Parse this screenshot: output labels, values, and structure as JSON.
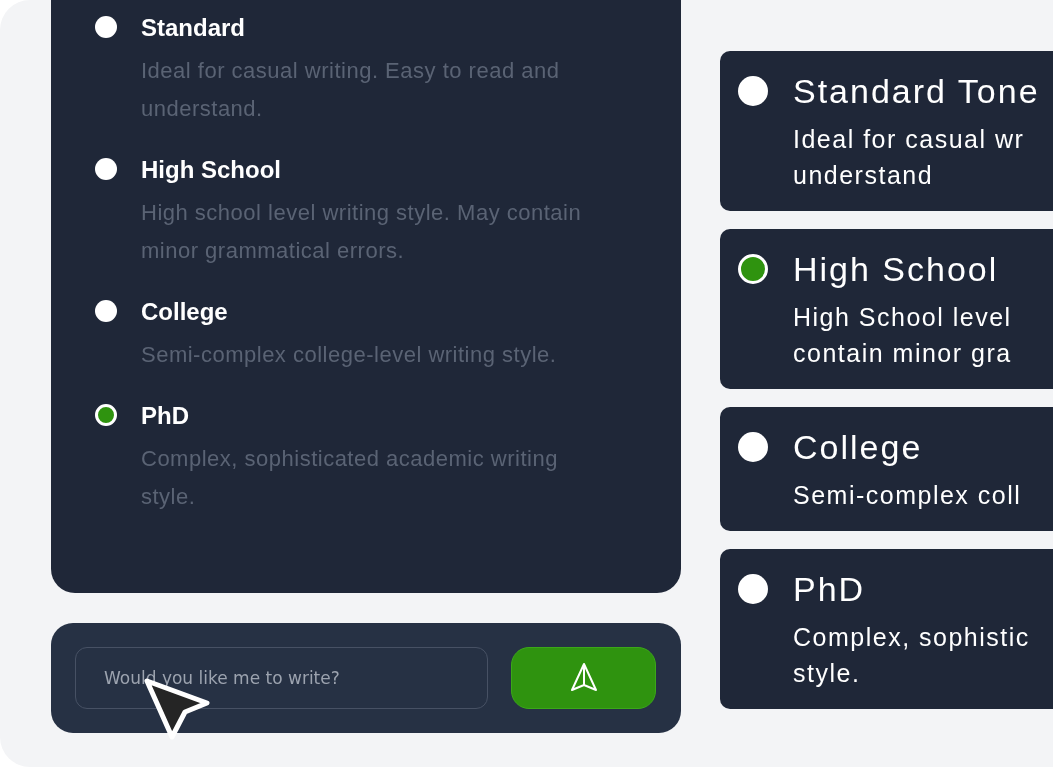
{
  "levels": [
    {
      "title": "Standard",
      "description": "Ideal for casual writing. Easy to read and understand.",
      "selected": false
    },
    {
      "title": "High School",
      "description": "High school level writing style. May contain minor grammatical errors.",
      "selected": false
    },
    {
      "title": "College",
      "description": "Semi-complex college-level writing style.",
      "selected": false
    },
    {
      "title": "PhD",
      "description": "Complex, sophisticated academic writing style.",
      "selected": true
    }
  ],
  "composer": {
    "placeholder": "Would you like me to write?"
  },
  "tone_cards": [
    {
      "title": "Standard Tone",
      "lines": [
        "Ideal for casual wr",
        "understand"
      ],
      "selected": false
    },
    {
      "title": "High School",
      "lines": [
        "High School level",
        "contain minor gra"
      ],
      "selected": true
    },
    {
      "title": "College",
      "lines": [
        "Semi-complex coll"
      ],
      "selected": false
    },
    {
      "title": "PhD",
      "lines": [
        "Complex, sophistic",
        "style."
      ],
      "selected": false
    }
  ]
}
